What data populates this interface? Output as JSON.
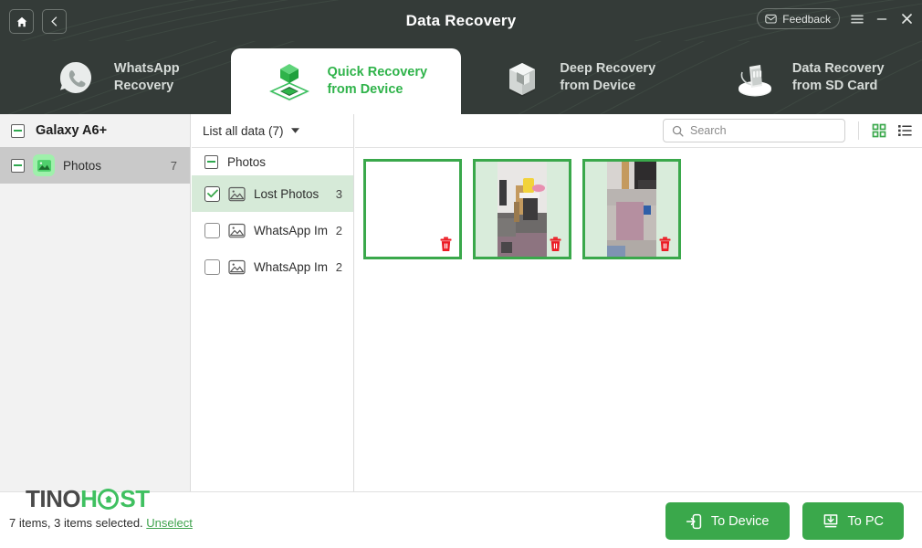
{
  "window": {
    "title": "Data Recovery",
    "home_icon": "home-icon",
    "back_icon": "chevron-left-icon",
    "feedback_label": "Feedback",
    "feedback_icon": "envelope-icon",
    "menu_icon": "hamburger-menu-icon",
    "minimize_icon": "minimize-icon",
    "close_icon": "close-icon",
    "bg_color": "#343b38"
  },
  "tabs": [
    {
      "line1": "WhatsApp",
      "line2": "Recovery",
      "icon": "whatsapp-phone-icon",
      "active": false
    },
    {
      "line1": "Quick Recovery",
      "line2": "from Device",
      "icon": "green-cube-icon",
      "active": true
    },
    {
      "line1": "Deep Recovery",
      "line2": "from Device",
      "icon": "grey-cube-icon",
      "active": false
    },
    {
      "line1": "Data Recovery",
      "line2": "from SD Card",
      "icon": "sd-card-icon",
      "active": false
    }
  ],
  "sidebar": {
    "device": {
      "label": "Galaxy A6+",
      "toggle": "collapse-box"
    },
    "items": [
      {
        "label": "Photos",
        "count": "7",
        "icon": "photos-icon",
        "selected": true
      }
    ]
  },
  "category_pane": {
    "filter_label": "List all data (7)",
    "filter_caret": "caret-down-icon",
    "group_label": "Photos",
    "rows": [
      {
        "label": "Lost Photos",
        "count": "3",
        "checked": true,
        "selected": true
      },
      {
        "label": "WhatsApp Im...",
        "count": "2",
        "checked": false,
        "selected": false
      },
      {
        "label": "WhatsApp Im...",
        "count": "2",
        "checked": false,
        "selected": false
      }
    ]
  },
  "toolbar": {
    "search_placeholder": "Search",
    "search_value": "",
    "search_icon": "search-icon",
    "grid_view_icon": "grid-view-icon",
    "list_view_icon": "list-view-icon",
    "active_view": "grid"
  },
  "thumbnails": [
    {
      "name": "thumbnail-1",
      "blank": true,
      "delete_icon": "trash-icon",
      "selected": true
    },
    {
      "name": "thumbnail-2",
      "blank": false,
      "delete_icon": "trash-icon",
      "selected": true
    },
    {
      "name": "thumbnail-3",
      "blank": false,
      "delete_icon": "trash-icon",
      "selected": true
    }
  ],
  "footer": {
    "logo_part1": "TINO",
    "logo_part2": "H",
    "logo_part3": "ST",
    "status_text": "7 items, 3 items selected.",
    "unselect_label": "Unselect",
    "buttons": [
      {
        "label": "To Device",
        "icon": "export-to-device-icon"
      },
      {
        "label": "To PC",
        "icon": "download-to-pc-icon"
      }
    ]
  },
  "colors": {
    "accent_green": "#3aa84b",
    "bright_green": "#2fb34a",
    "dark_bg": "#343b38",
    "selected_row": "#d6ead8"
  }
}
